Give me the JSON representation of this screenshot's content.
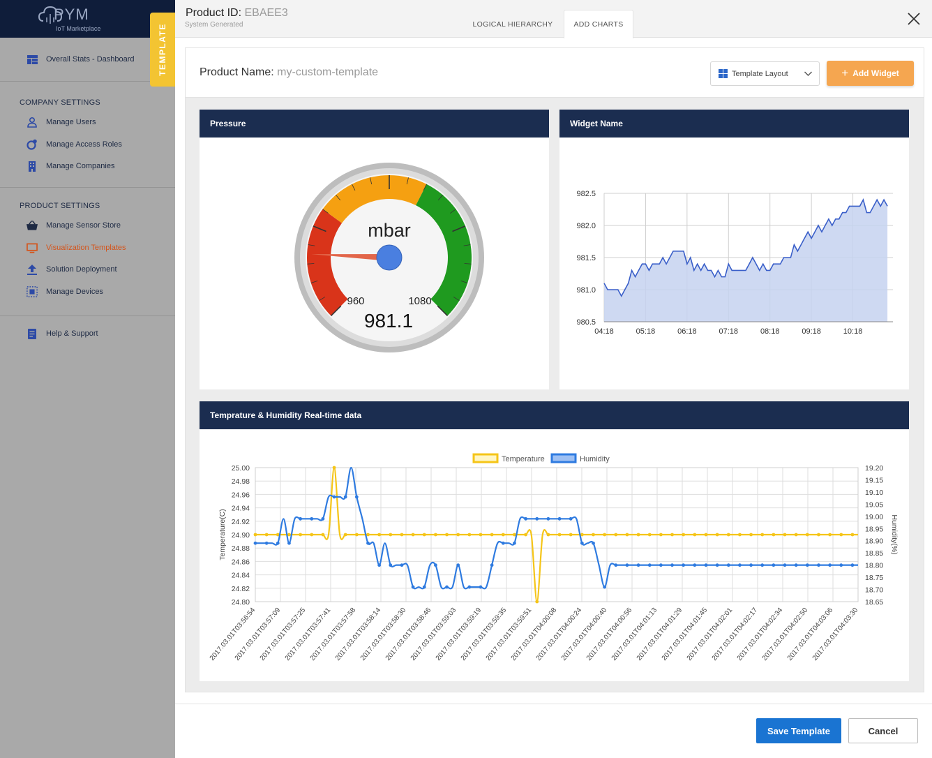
{
  "sidebar": {
    "logo_text": "PYM",
    "logo_sub": "IoT Marketplace",
    "dashboard_label": "Overall Stats - Dashboard",
    "company_heading": "COMPANY SETTINGS",
    "company_items": [
      {
        "label": "Manage Users",
        "icon": "user-icon"
      },
      {
        "label": "Manage Access Roles",
        "icon": "roles-icon"
      },
      {
        "label": "Manage Companies",
        "icon": "building-icon"
      }
    ],
    "product_heading": "PRODUCT SETTINGS",
    "product_items": [
      {
        "label": "Manage Sensor Store",
        "icon": "basket-icon"
      },
      {
        "label": "Visualization Templates",
        "icon": "monitor-icon",
        "active": true
      },
      {
        "label": "Solution Deployment",
        "icon": "upload-icon"
      },
      {
        "label": "Manage Devices",
        "icon": "devices-icon"
      }
    ],
    "help_label": "Help & Support",
    "template_tab": "TEMPLATE"
  },
  "header": {
    "product_id_label": "Product ID: ",
    "product_id_value": "EBAEE3",
    "product_id_sub": "System Generated",
    "tabs": [
      "LOGICAL HIERARCHY",
      "ADD CHARTS"
    ],
    "active_tab": "ADD CHARTS"
  },
  "toolbar": {
    "product_name_label": "Product Name: ",
    "product_name_value": "my-custom-template",
    "layout_select": "Template Layout",
    "add_widget": "Add Widget"
  },
  "widgets": {
    "gauge_title": "Pressure",
    "line_title": "Widget Name",
    "combo_title": "Temprature & Humidity Real-time data"
  },
  "footer": {
    "save": "Save Template",
    "cancel": "Cancel"
  },
  "colors": {
    "navy": "#1b2d50",
    "accent_orange": "#f5a650",
    "save_blue": "#1a74d2",
    "temperature": "#f5c518",
    "humidity": "#2f7be0",
    "area_fill": "#c5d2f0",
    "gauge_red": "#d9341a",
    "gauge_orange": "#f5a011",
    "gauge_green": "#1f9a1f"
  },
  "chart_data": [
    {
      "type": "gauge",
      "title": "Pressure",
      "unit": "mbar",
      "min": 960,
      "max": 1080,
      "value": 981.1,
      "min_label": "960",
      "max_label": "1080",
      "value_label": "981.1"
    },
    {
      "type": "area",
      "title": "Widget Name",
      "x_ticks": [
        "04:18",
        "05:18",
        "06:18",
        "07:18",
        "08:18",
        "09:18",
        "10:18"
      ],
      "y_ticks": [
        "980.5",
        "981.0",
        "981.5",
        "982.0",
        "982.5"
      ],
      "ylim": [
        980.5,
        982.5
      ],
      "x_minutes": [
        0,
        5,
        10,
        15,
        20,
        25,
        30,
        35,
        40,
        45,
        50,
        55,
        60,
        65,
        70,
        75,
        80,
        85,
        90,
        95,
        100,
        105,
        110,
        115,
        120,
        125,
        130,
        135,
        140,
        145,
        150,
        155,
        160,
        165,
        170,
        175,
        180,
        185,
        190,
        195,
        200,
        205,
        210,
        215,
        220,
        225,
        230,
        235,
        240,
        245,
        250,
        255,
        260,
        265,
        270,
        275,
        280,
        285,
        290,
        295,
        300,
        305,
        310,
        315,
        320,
        325,
        330,
        335,
        340,
        345,
        350,
        355,
        360,
        365,
        370,
        375,
        380,
        385,
        390,
        395,
        400,
        405,
        410
      ],
      "values": [
        981.1,
        981.0,
        981.0,
        981.0,
        981.0,
        980.9,
        981.0,
        981.1,
        981.3,
        981.2,
        981.3,
        981.4,
        981.4,
        981.3,
        981.4,
        981.4,
        981.4,
        981.5,
        981.4,
        981.5,
        981.6,
        981.6,
        981.6,
        981.6,
        981.4,
        981.5,
        981.3,
        981.4,
        981.3,
        981.4,
        981.3,
        981.3,
        981.2,
        981.3,
        981.2,
        981.2,
        981.4,
        981.3,
        981.3,
        981.3,
        981.3,
        981.3,
        981.4,
        981.5,
        981.4,
        981.3,
        981.4,
        981.3,
        981.3,
        981.4,
        981.4,
        981.4,
        981.5,
        981.5,
        981.5,
        981.7,
        981.6,
        981.7,
        981.8,
        981.9,
        981.8,
        981.9,
        982.0,
        981.9,
        982.0,
        982.1,
        982.0,
        982.1,
        982.1,
        982.2,
        982.2,
        982.3,
        982.3,
        982.3,
        982.3,
        982.4,
        982.2,
        982.2,
        982.3,
        982.4,
        982.3,
        982.4,
        982.3
      ],
      "x_range_minutes": [
        0,
        418
      ]
    },
    {
      "type": "line",
      "title": "Temprature & Humidity Real-time data",
      "ylabel": "Temperature(C)",
      "y2label": "Humidity(%)",
      "ylim": [
        24.8,
        25.0
      ],
      "y2lim": [
        18.65,
        19.2
      ],
      "y_ticks": [
        "24.80",
        "24.82",
        "24.84",
        "24.86",
        "24.88",
        "24.90",
        "24.92",
        "24.94",
        "24.96",
        "24.98",
        "25.00"
      ],
      "y2_ticks": [
        "18.65",
        "18.70",
        "18.75",
        "18.80",
        "18.85",
        "18.90",
        "18.95",
        "19.00",
        "19.05",
        "19.10",
        "19.15",
        "19.20"
      ],
      "x": [
        "2017-03-01T03:56:54",
        "2017-03-01T03:57:09",
        "2017-03-01T03:57:25",
        "2017-03-01T03:57:41",
        "2017-03-01T03:57:58",
        "2017-03-01T03:58:14",
        "2017-03-01T03:58:30",
        "2017-03-01T03:58:46",
        "2017-03-01T03:59:03",
        "2017-03-01T03:59:19",
        "2017-03-01T03:59:35",
        "2017-03-01T03:59:51",
        "2017-03-01T04:00:08",
        "2017-03-01T04:00:24",
        "2017-03-01T04:00:40",
        "2017-03-01T04:00:56",
        "2017-03-01T04:01:13",
        "2017-03-01T04:01:29",
        "2017-03-01T04:01:45",
        "2017-03-01T04:02:01",
        "2017-03-01T04:02:17",
        "2017-03-01T04:02:34",
        "2017-03-01T04:02:50",
        "2017-03-01T04:03:06",
        "2017-03-01T04:03:30"
      ],
      "x_labels": [
        "2017.03.01T03:56:54",
        "2017.03.01T03:57:09",
        "2017.03.01T03:57:25",
        "2017.03.01T03:57:41",
        "2017.03.01T03:57:58",
        "2017.03.01T03:58:14",
        "2017.03.01T03:58:30",
        "2017.03.01T03:58:46",
        "2017.03.01T03:59:03",
        "2017.03.01T03:59:19",
        "2017.03.01T03:59:35",
        "2017.03.01T03:59:51",
        "2017.03.01T04:00:08",
        "2017.03.01T04:00:24",
        "2017.03.01T04:00:40",
        "2017.03.01T04:00:56",
        "2017.03.01T04:01:13",
        "2017.03.01T04:01:29",
        "2017.03.01T04:01:45",
        "2017.03.01T04:02:01",
        "2017.03.01T04:02:17",
        "2017.03.01T04:02:34",
        "2017.03.01T04:02:50",
        "2017.03.01T04:03:06",
        "2017.03.01T04:03:30"
      ],
      "series": [
        {
          "name": "Temperature",
          "axis": "left",
          "values": [
            24.9,
            24.9,
            24.9,
            24.9,
            24.9,
            24.9,
            24.9,
            24.9,
            24.9,
            24.9,
            24.9,
            24.9,
            24.9,
            24.9,
            25.0,
            24.9,
            24.9,
            24.9,
            24.9,
            24.9,
            24.9,
            24.9,
            24.9,
            24.9,
            24.9,
            24.9,
            24.9,
            24.9,
            24.9,
            24.9,
            24.9,
            24.9,
            24.9,
            24.9,
            24.9,
            24.9,
            24.9,
            24.9,
            24.9,
            24.9,
            24.9,
            24.9,
            24.9,
            24.9,
            24.9,
            24.9,
            24.9,
            24.9,
            24.9,
            24.9,
            24.8,
            24.9,
            24.9,
            24.9,
            24.9,
            24.9,
            24.9,
            24.9,
            24.9,
            24.9,
            24.9,
            24.9,
            24.9,
            24.9,
            24.9,
            24.9,
            24.9,
            24.9,
            24.9,
            24.9,
            24.9,
            24.9,
            24.9,
            24.9,
            24.9,
            24.9,
            24.9,
            24.9,
            24.9,
            24.9,
            24.9,
            24.9,
            24.9,
            24.9,
            24.9,
            24.9,
            24.9,
            24.9,
            24.9,
            24.9,
            24.9,
            24.9,
            24.9,
            24.9,
            24.9,
            24.9,
            24.9,
            24.9,
            24.9,
            24.9,
            24.9,
            24.9,
            24.9,
            24.9,
            24.9,
            24.9,
            24.9,
            24.9
          ]
        },
        {
          "name": "Humidity",
          "axis": "right",
          "values": [
            18.89,
            18.89,
            18.89,
            18.89,
            18.89,
            18.99,
            18.89,
            18.99,
            18.99,
            18.99,
            18.99,
            18.99,
            18.99,
            19.08,
            19.08,
            19.08,
            19.08,
            19.2,
            19.08,
            18.99,
            18.89,
            18.89,
            18.8,
            18.89,
            18.8,
            18.8,
            18.8,
            18.8,
            18.71,
            18.71,
            18.71,
            18.8,
            18.8,
            18.71,
            18.71,
            18.71,
            18.8,
            18.71,
            18.71,
            18.71,
            18.71,
            18.71,
            18.8,
            18.89,
            18.89,
            18.89,
            18.89,
            18.99,
            18.99,
            18.99,
            18.99,
            18.99,
            18.99,
            18.99,
            18.99,
            18.99,
            18.99,
            18.99,
            18.89,
            18.89,
            18.89,
            18.8,
            18.71,
            18.8,
            18.8,
            18.8,
            18.8,
            18.8,
            18.8,
            18.8,
            18.8,
            18.8,
            18.8,
            18.8,
            18.8,
            18.8,
            18.8,
            18.8,
            18.8,
            18.8,
            18.8,
            18.8,
            18.8,
            18.8,
            18.8,
            18.8,
            18.8,
            18.8,
            18.8,
            18.8,
            18.8,
            18.8,
            18.8,
            18.8,
            18.8,
            18.8,
            18.8,
            18.8,
            18.8,
            18.8,
            18.8,
            18.8,
            18.8,
            18.8,
            18.8,
            18.8,
            18.8,
            18.8
          ]
        }
      ],
      "legend": "top-center"
    }
  ]
}
